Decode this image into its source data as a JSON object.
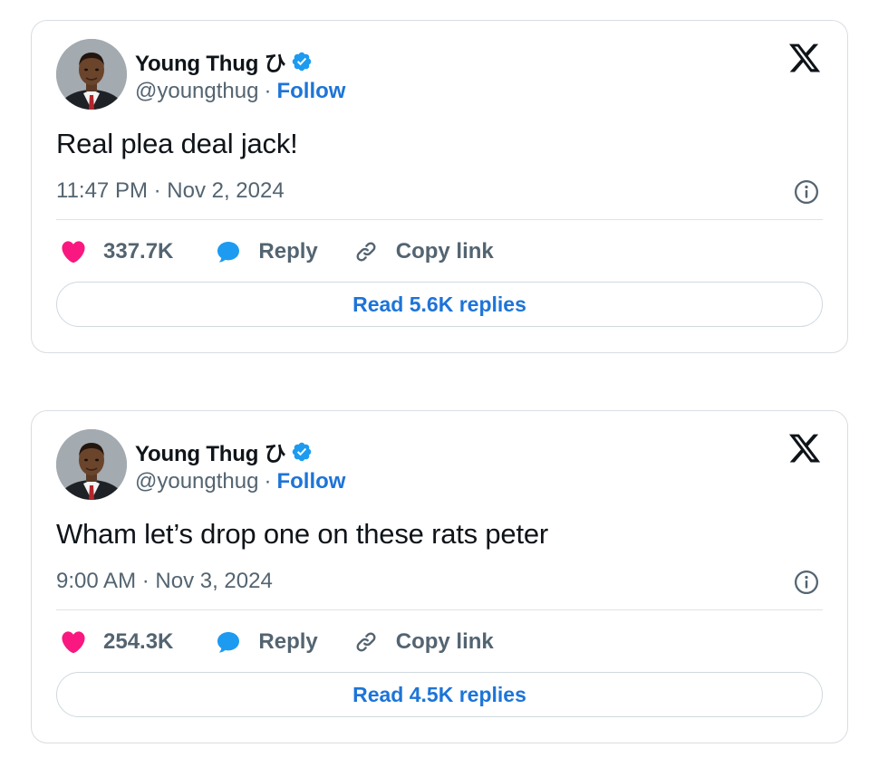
{
  "colors": {
    "text_primary": "#0f1419",
    "text_secondary": "#536471",
    "link_blue": "#1d74d8",
    "verified_blue": "#1d9bf0",
    "heart_pink": "#f91880",
    "border": "#d9dde1"
  },
  "icons": {
    "verified": "verified-badge-icon",
    "logo": "x-logo-icon",
    "info": "info-icon",
    "like": "heart-icon",
    "reply": "speech-bubble-icon",
    "copy": "link-icon"
  },
  "tweets": [
    {
      "author": {
        "display_name": "Young Thug ひ",
        "handle": "@youngthug",
        "follow_label": "Follow",
        "separator": "·"
      },
      "text": "Real plea deal jack!",
      "timestamp": "11:47 PM · Nov 2, 2024",
      "likes": "337.7K",
      "reply_label": "Reply",
      "copy_link_label": "Copy link",
      "read_replies_label": "Read 5.6K replies"
    },
    {
      "author": {
        "display_name": "Young Thug ひ",
        "handle": "@youngthug",
        "follow_label": "Follow",
        "separator": "·"
      },
      "text": "Wham let’s drop one on these rats peter",
      "timestamp": "9:00 AM · Nov 3, 2024",
      "likes": "254.3K",
      "reply_label": "Reply",
      "copy_link_label": "Copy link",
      "read_replies_label": "Read 4.5K replies"
    }
  ]
}
